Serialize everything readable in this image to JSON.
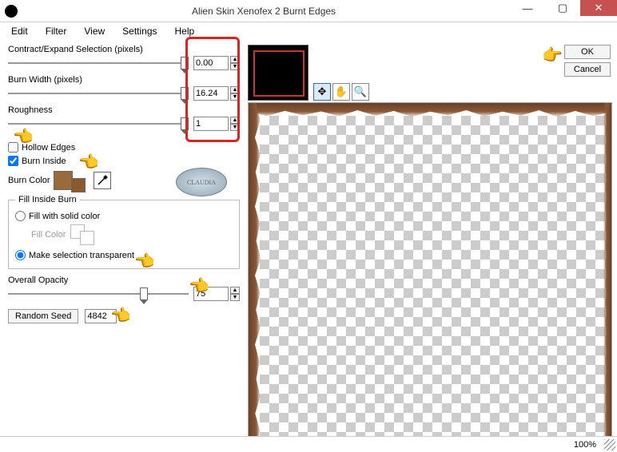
{
  "titlebar": {
    "title": "Alien Skin Xenofex 2 Burnt Edges"
  },
  "menu": {
    "edit": "Edit",
    "filter": "Filter",
    "view": "View",
    "settings": "Settings",
    "help": "Help"
  },
  "params": {
    "contract_label": "Contract/Expand Selection (pixels)",
    "contract_value": "0.00",
    "burnwidth_label": "Burn Width (pixels)",
    "burnwidth_value": "16.24",
    "roughness_label": "Roughness",
    "roughness_value": "1"
  },
  "checks": {
    "hollow_label": "Hollow Edges",
    "hollow_checked": false,
    "inside_label": "Burn Inside",
    "inside_checked": true
  },
  "burncolor": {
    "label": "Burn Color",
    "primary": "#9a6b3a",
    "secondary": "#8a5a2e"
  },
  "fillgroup": {
    "legend": "Fill Inside Burn",
    "solid_label": "Fill with solid color",
    "fillcolor_label": "Fill Color",
    "transparent_label": "Make selection transparent",
    "selected": "transparent"
  },
  "opacity": {
    "label": "Overall Opacity",
    "value": "75"
  },
  "seed": {
    "button": "Random Seed",
    "value": "4842"
  },
  "buttons": {
    "ok": "OK",
    "cancel": "Cancel"
  },
  "status": {
    "zoom": "100%"
  },
  "watermark": "CLAUDIA"
}
